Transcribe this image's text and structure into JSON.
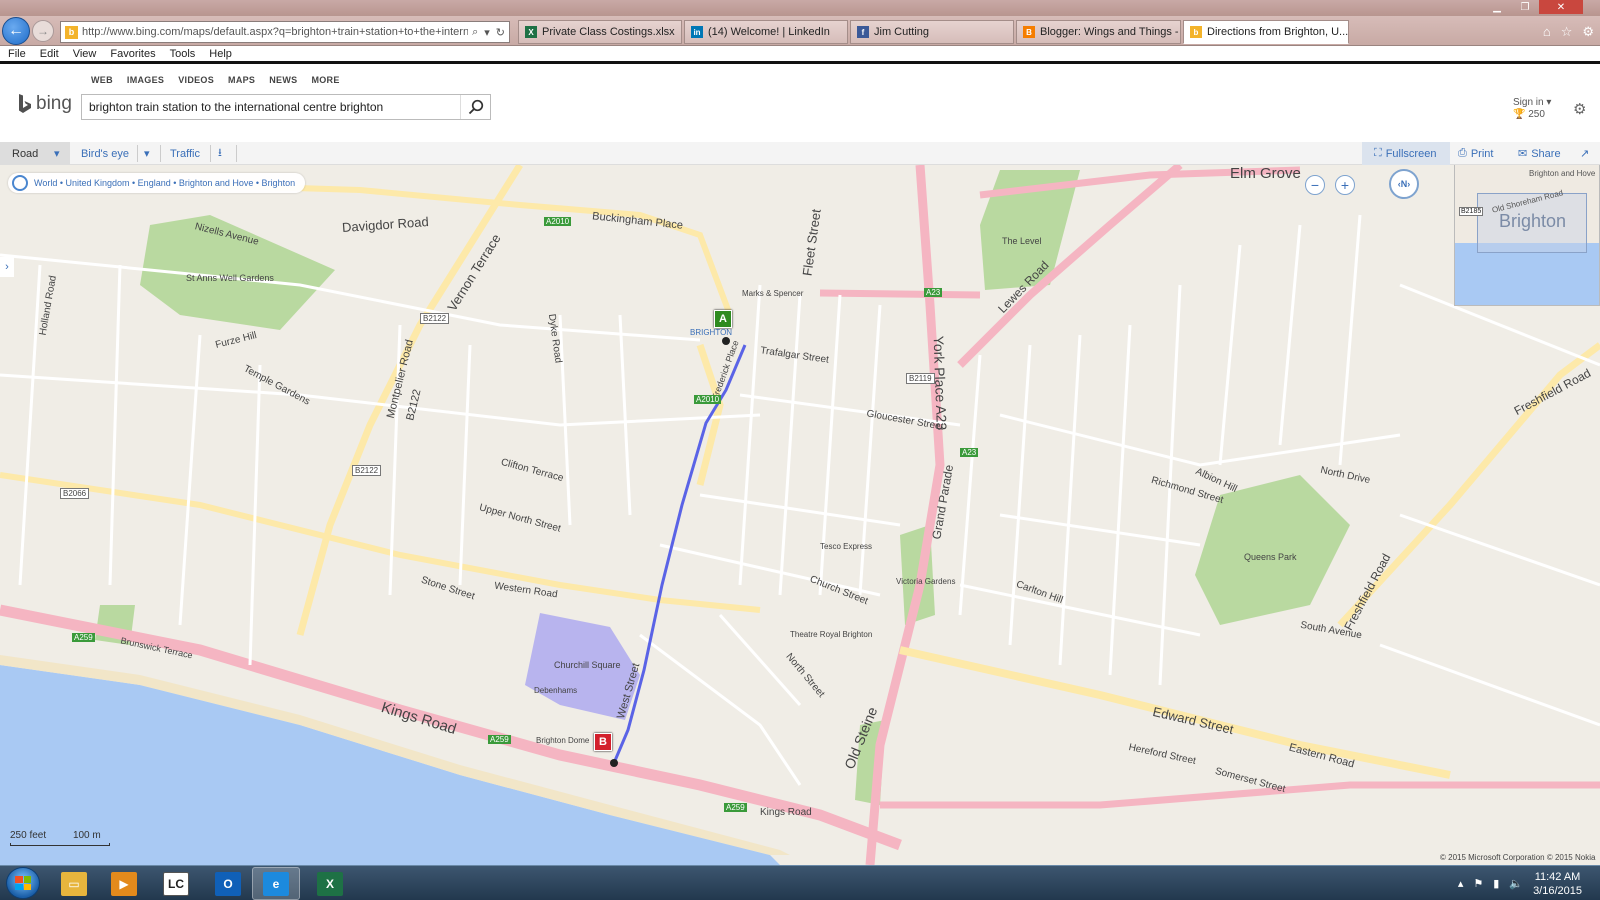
{
  "browser": {
    "url": "http://www.bing.com/maps/default.aspx?q=brighton+train+station+to+the+internatio",
    "tabs": [
      {
        "label": "Private Class Costings.xlsx",
        "icon": "excel-icon",
        "color": "#1e7145",
        "glyph": "X"
      },
      {
        "label": "(14) Welcome! | LinkedIn",
        "icon": "linkedin-icon",
        "color": "#0077b5",
        "glyph": "in"
      },
      {
        "label": "Jim Cutting",
        "icon": "facebook-icon",
        "color": "#3b5998",
        "glyph": "f"
      },
      {
        "label": "Blogger: Wings and Things - C...",
        "icon": "blogger-icon",
        "color": "#f57d00",
        "glyph": "B"
      },
      {
        "label": "Directions from Brighton, U...",
        "icon": "bing-icon",
        "color": "#f3b32a",
        "glyph": "b",
        "active": true
      }
    ],
    "menu": [
      "File",
      "Edit",
      "View",
      "Favorites",
      "Tools",
      "Help"
    ]
  },
  "bing": {
    "verticals": [
      "WEB",
      "IMAGES",
      "VIDEOS",
      "MAPS",
      "NEWS",
      "MORE"
    ],
    "logo_text": "bing",
    "search_query": "brighton train station to the international centre brighton",
    "signin": "Sign in",
    "rewards": "250"
  },
  "maptoolbar": {
    "road": "Road",
    "birds_eye": "Bird's eye",
    "traffic": "Traffic",
    "fullscreen": "Fullscreen",
    "print": "Print",
    "share": "Share"
  },
  "map": {
    "breadcrumb": "World • United Kingdom • England • Brighton and Hove • Brighton",
    "compass": "N",
    "minimap": {
      "title": "Brighton",
      "label1": "Brighton and Hove",
      "label2": "Old Shoreham Road",
      "label3": "B2185"
    },
    "scale_feet": "250 feet",
    "scale_m": "100 m",
    "copyright": "© 2015 Microsoft Corporation   © 2015 Nokia",
    "marker_a": "A",
    "marker_b": "B",
    "labels": {
      "elm_grove": "Elm Grove",
      "davigdor": "Davigdor Road",
      "buckingham_place": "Buckingham Place",
      "vernon": "Vernon Terrace",
      "fleet": "Fleet Street",
      "york_place": "York Place A23",
      "lewes": "Lewes Road",
      "kings_road": "Kings Road",
      "kings_road2": "Kings Road",
      "old_steine": "Old Steine",
      "edward": "Edward Street",
      "freshfield": "Freshfield Road",
      "freshfield2": "Freshfield Road",
      "grand_parade": "Grand Parade",
      "gloucester": "Gloucester Street",
      "trafalgar": "Trafalgar Street",
      "western": "Western Road",
      "north_street": "North Street",
      "church": "Church Street",
      "eastern": "Eastern Road",
      "somerset": "Somerset Street",
      "upper_north": "Upper North Street",
      "clifton": "Clifton Terrace",
      "b2122": "B2122",
      "b2122b": "B2122",
      "b2122c": "B2122",
      "a23": "A23",
      "a23b": "A23",
      "a259": "A259",
      "a259b": "A259",
      "a259c": "A259",
      "a2010": "A2010",
      "a2010b": "A2010",
      "b2119": "B2119",
      "b2066": "B2066",
      "west_street": "West Street",
      "churchill": "Churchill Square",
      "the_level": "The Level",
      "queens_park": "Queens Park",
      "st_anns": "St Anns Well Gardens",
      "victoria_gardens": "Victoria Gardens",
      "brighton_stn": "BRIGHTON",
      "brighton_dome": "Brighton Dome",
      "nizells": "Nizells Avenue",
      "montpelier": "Montpelier Road",
      "holland": "Holland Road",
      "furze": "Furze Hill",
      "north_drive": "North Drive",
      "albion": "Albion Hill",
      "richmond": "Richmond Street",
      "carlton": "Carlton Hill",
      "south_ave": "South Avenue",
      "hereford": "Hereford Street",
      "brunswick": "Brunswick Terrace",
      "stone": "Stone Street",
      "temple": "Temple Gardens",
      "dyke": "Dyke Road",
      "queens_road": "Frederick Place",
      "tesco": "Tesco Express",
      "debenhams": "Debenhams",
      "theatre": "Theatre Royal Brighton",
      "marks": "Marks & Spencer"
    }
  },
  "taskbar": {
    "time": "11:42 AM",
    "date": "3/16/2015",
    "apps": [
      {
        "name": "file-explorer",
        "color": "#e7b53d",
        "glyph": "▭"
      },
      {
        "name": "media-player",
        "color": "#e38a1c",
        "glyph": "▶"
      },
      {
        "name": "lc-app",
        "color": "#fff",
        "glyph": "LC"
      },
      {
        "name": "outlook",
        "color": "#1060b8",
        "glyph": "O"
      },
      {
        "name": "internet-explorer",
        "color": "#1c8ade",
        "glyph": "e",
        "active": true
      },
      {
        "name": "excel",
        "color": "#1e7145",
        "glyph": "X"
      }
    ]
  }
}
